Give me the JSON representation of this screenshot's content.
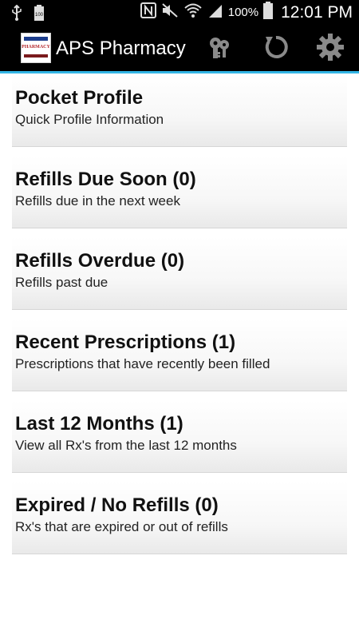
{
  "status_bar": {
    "battery_percent": "100%",
    "time": "12:01 PM",
    "icons": [
      "usb-icon",
      "battery-100-icon",
      "nfc-icon",
      "mute-icon",
      "wifi-icon",
      "signal-icon",
      "battery-icon"
    ],
    "small_battery_label": "100"
  },
  "action_bar": {
    "title": "APS Pharmacy",
    "logo_text": "PHARMACY",
    "accent_color": "#33b5e5",
    "actions": [
      "key-icon",
      "refresh-icon",
      "settings-icon"
    ]
  },
  "menu": {
    "items": [
      {
        "title": "Pocket Profile",
        "subtitle": "Quick Profile Information"
      },
      {
        "title": "Refills Due Soon (0)",
        "subtitle": "Refills due in the next week"
      },
      {
        "title": "Refills Overdue (0)",
        "subtitle": "Refills past due"
      },
      {
        "title": "Recent Prescriptions (1)",
        "subtitle": "Prescriptions that have recently been filled"
      },
      {
        "title": "Last 12 Months (1)",
        "subtitle": "View all Rx's from the last 12 months"
      },
      {
        "title": "Expired / No Refills (0)",
        "subtitle": "Rx's that are expired or out of refills"
      }
    ]
  }
}
